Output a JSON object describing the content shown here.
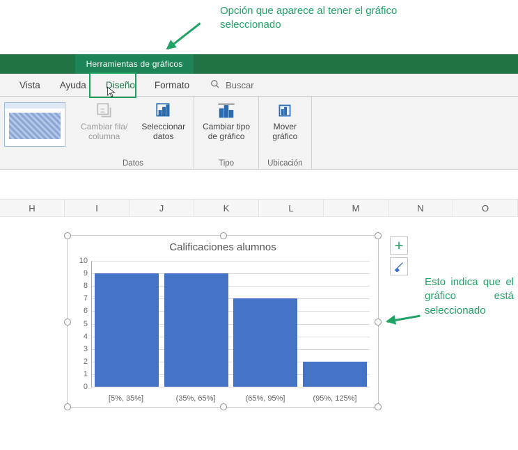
{
  "annotations": {
    "top": "Opción que aparece al tener el gráfico seleccionado",
    "right": "Esto indica que el gráfico está seleccionado"
  },
  "ribbon": {
    "context_tab": "Herramientas de gráficos",
    "tabs": [
      "Vista",
      "Ayuda",
      "Diseño",
      "Formato"
    ],
    "active_tab": "Diseño",
    "search_label": "Buscar",
    "groups": {
      "datos": {
        "label": "Datos",
        "switch_rowcol": "Cambiar fila/\ncolumna",
        "select_data": "Seleccionar\ndatos"
      },
      "tipo": {
        "label": "Tipo",
        "change_type": "Cambiar tipo\nde gráfico"
      },
      "ubicacion": {
        "label": "Ubicación",
        "move_chart": "Mover\ngráfico"
      }
    }
  },
  "sheet": {
    "columns": [
      "H",
      "I",
      "J",
      "K",
      "L",
      "M",
      "N",
      "O"
    ]
  },
  "side_buttons": {
    "add": "+",
    "brush": "brush-icon"
  },
  "chart_data": {
    "type": "bar",
    "title": "Calificaciones alumnos",
    "categories": [
      "[5%, 35%]",
      "(35%, 65%]",
      "(65%, 95%]",
      "(95%, 125%]"
    ],
    "values": [
      9,
      9,
      7,
      2
    ],
    "ylim": [
      0,
      10
    ],
    "yticks": [
      0,
      1,
      2,
      3,
      4,
      5,
      6,
      7,
      8,
      9,
      10
    ],
    "xlabel": "",
    "ylabel": ""
  }
}
